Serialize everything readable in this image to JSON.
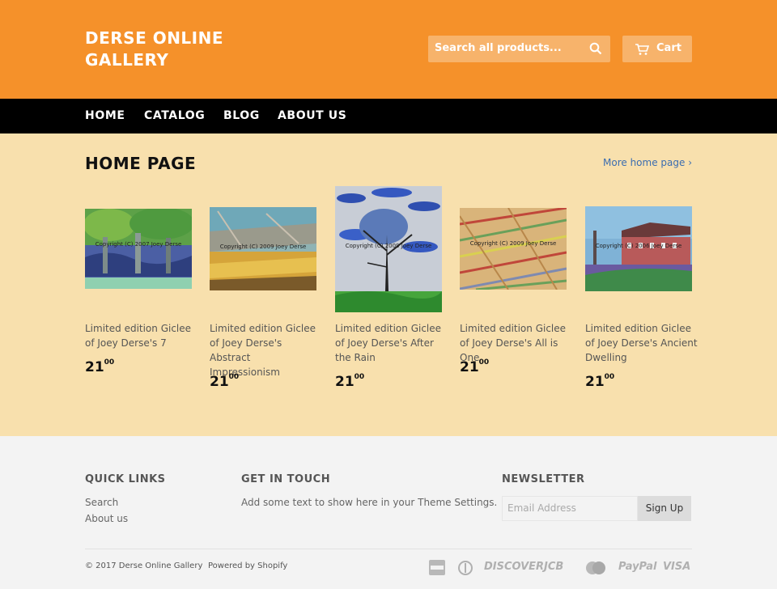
{
  "header": {
    "logo_line1": "DERSE ONLINE",
    "logo_line2": "GALLERY",
    "search_placeholder": "Search all products...",
    "cart_label": "Cart"
  },
  "nav": {
    "items": [
      {
        "label": "HOME"
      },
      {
        "label": "CATALOG"
      },
      {
        "label": "BLOG"
      },
      {
        "label": "ABOUT US"
      }
    ]
  },
  "main": {
    "title": "HOME PAGE",
    "more_link": "More home page ›",
    "products": [
      {
        "title": "Limited edition Giclee of Joey Derse's 7",
        "price_main": "21",
        "price_cents": "00",
        "watermark": "Copyright (C) 2007 Joey Derse"
      },
      {
        "title": "Limited edition Giclee of Joey Derse's Abstract Impressionism",
        "price_main": "21",
        "price_cents": "00",
        "watermark": "Copyright (C) 2009 Joey Derse"
      },
      {
        "title": "Limited edition Giclee of Joey Derse's After the Rain",
        "price_main": "21",
        "price_cents": "00",
        "watermark": "Copyright (C) 2009 Joey Derse"
      },
      {
        "title": "Limited edition Giclee of Joey Derse's All is One",
        "price_main": "21",
        "price_cents": "00",
        "watermark": "Copyright (C) 2009 Joey Derse"
      },
      {
        "title": "Limited edition Giclee of Joey Derse's Ancient Dwelling",
        "price_main": "21",
        "price_cents": "00",
        "watermark": "Copyright (C) 2006 Joey Derse"
      }
    ]
  },
  "footer": {
    "quick_links_heading": "QUICK LINKS",
    "quick_links": [
      {
        "label": "Search"
      },
      {
        "label": "About us"
      }
    ],
    "touch_heading": "GET IN TOUCH",
    "touch_text": "Add some text to show here in your Theme Settings.",
    "newsletter_heading": "NEWSLETTER",
    "email_placeholder": "Email Address",
    "signup_label": "Sign Up",
    "copyright": "© 2017 Derse Online Gallery",
    "powered": "Powered by Shopify",
    "payment_icons": [
      "american-express",
      "diners-club",
      "discover",
      "jcb",
      "master",
      "paypal",
      "visa"
    ],
    "payment_labels": {
      "discover": "DISCOVER",
      "jcb": "JCB",
      "paypal": "PayPal",
      "visa": "VISA"
    }
  },
  "colors": {
    "header_bg": "#f5912a",
    "nav_bg": "#000000",
    "main_bg": "#f8e0ad",
    "footer_bg": "#f3f3f3",
    "link": "#3b6db0"
  }
}
